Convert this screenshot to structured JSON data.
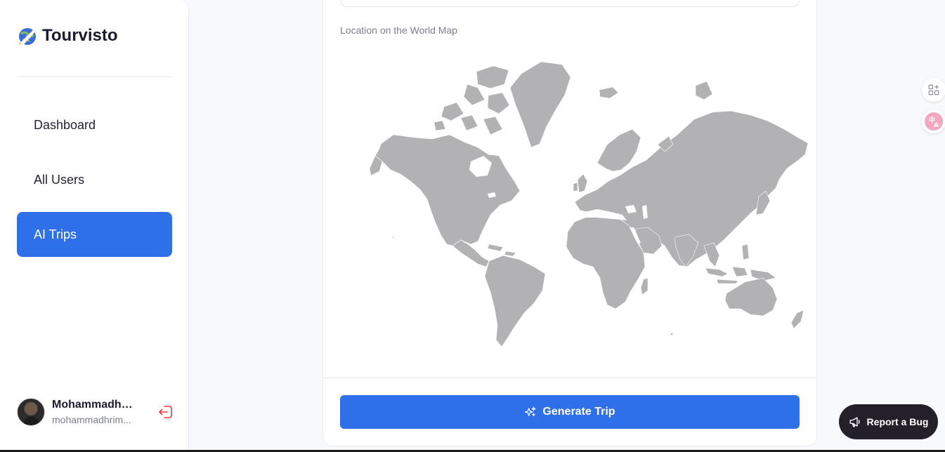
{
  "brand": {
    "name": "Tourvisto",
    "logo_icon": "globe-plane-icon"
  },
  "nav": {
    "items": [
      {
        "label": "Dashboard",
        "active": false
      },
      {
        "label": "All Users",
        "active": false
      },
      {
        "label": "AI Trips",
        "active": true
      }
    ]
  },
  "user": {
    "name": "Mohammadh ...",
    "email": "mohammadhrim..."
  },
  "main": {
    "map_label": "Location on the World Map",
    "generate_button_label": "Generate Trip",
    "generate_icon": "sparkles-icon"
  },
  "floating": {
    "report_bug_label": "Report a Bug",
    "report_bug_icon": "megaphone-icon",
    "widgets": [
      "grid-plus-icon",
      "translate-icon"
    ]
  },
  "colors": {
    "accent": "#2f6fe8",
    "map_land": "#b2b1b3",
    "logout": "#e53935"
  }
}
